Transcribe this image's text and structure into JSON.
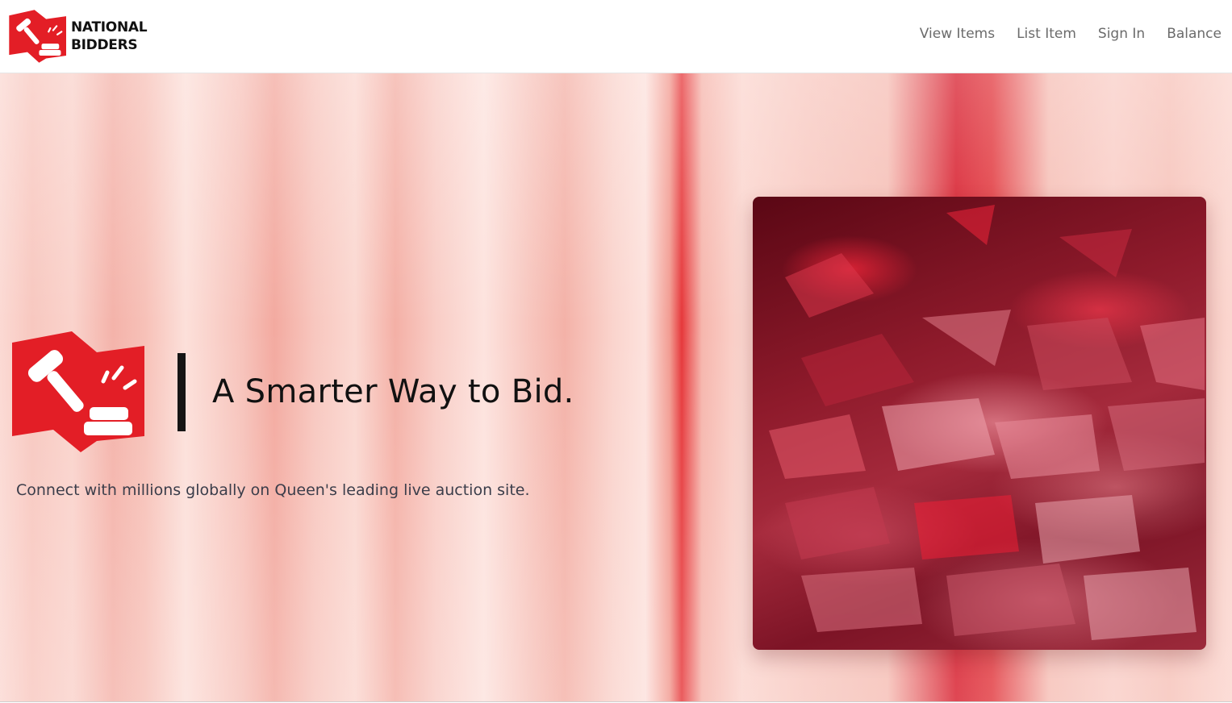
{
  "brand": {
    "name_line1": "NATIONAL",
    "name_line2": "BIDDERS",
    "logo_icon": "gavel-icon",
    "color": "#e31e26"
  },
  "nav": {
    "items": [
      {
        "label": "View Items"
      },
      {
        "label": "List Item"
      },
      {
        "label": "Sign In"
      },
      {
        "label": "Balance"
      }
    ]
  },
  "hero": {
    "tagline": "A Smarter Way to Bid.",
    "subtext": "Connect with millions globally on Queen's leading live auction site.",
    "logo_icon": "gavel-icon",
    "image": "red-polygon-abstract-image"
  },
  "colors": {
    "accent": "#e31e26",
    "nav_text": "#6b6b6b",
    "tagline_text": "#111111",
    "subtext": "#3b3d4a"
  }
}
